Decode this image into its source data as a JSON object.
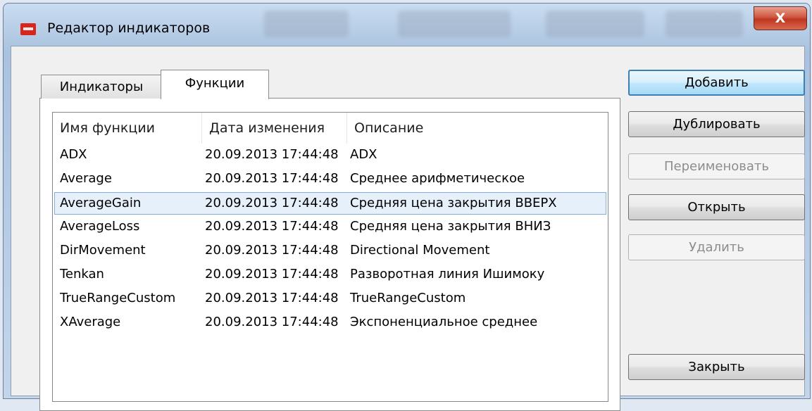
{
  "window": {
    "title": "Редактор индикаторов",
    "close_glyph": "X"
  },
  "tabs": [
    {
      "label": "Индикаторы",
      "active": false
    },
    {
      "label": "Функции",
      "active": true
    }
  ],
  "list": {
    "columns": [
      "Имя функции",
      "Дата изменения",
      "Описание"
    ],
    "rows": [
      {
        "name": "ADX",
        "date": "20.09.2013 17:44:48",
        "description": "ADX"
      },
      {
        "name": "Average",
        "date": "20.09.2013 17:44:48",
        "description": "Среднее арифметическое"
      },
      {
        "name": "AverageGain",
        "date": "20.09.2013 17:44:48",
        "description": "Средняя цена закрытия ВВЕРХ",
        "selected": true
      },
      {
        "name": "AverageLoss",
        "date": "20.09.2013 17:44:48",
        "description": "Средняя цена закрытия ВНИЗ"
      },
      {
        "name": "DirMovement",
        "date": "20.09.2013 17:44:48",
        "description": "Directional Movement"
      },
      {
        "name": "Tenkan",
        "date": "20.09.2013 17:44:48",
        "description": "Разворотная линия Ишимоку"
      },
      {
        "name": "TrueRangeCustom",
        "date": "20.09.2013 17:44:48",
        "description": "TrueRangeCustom"
      },
      {
        "name": "XAverage",
        "date": "20.09.2013 17:44:48",
        "description": "Экспоненциальное среднее"
      }
    ]
  },
  "buttons": {
    "add": "Добавить",
    "duplicate": "Дублировать",
    "rename": "Переименовать",
    "open": "Открыть",
    "delete": "Удалить",
    "close": "Закрыть"
  },
  "icons": {
    "app": "app-logo-icon",
    "close": "close-icon"
  },
  "colors": {
    "selection_bg": "#e6f0fb",
    "selection_border": "#84acdd",
    "default_button_border": "#3c7fb1",
    "disabled_text": "#8d8d8d"
  }
}
